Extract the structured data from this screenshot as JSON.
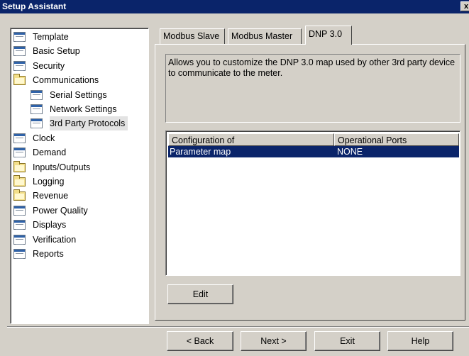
{
  "window": {
    "title": "Setup Assistant",
    "close_label": "x"
  },
  "tree": {
    "selected": "3rd Party Protocols",
    "items": [
      {
        "label": "Template",
        "icon": "doc-icon"
      },
      {
        "label": "Basic Setup",
        "icon": "doc-icon"
      },
      {
        "label": "Security",
        "icon": "doc-icon"
      },
      {
        "label": "Communications",
        "icon": "folder-icon"
      },
      {
        "label": "Serial Settings",
        "icon": "doc-icon"
      },
      {
        "label": "Network Settings",
        "icon": "doc-icon"
      },
      {
        "label": "3rd Party Protocols",
        "icon": "doc-icon"
      },
      {
        "label": "Clock",
        "icon": "doc-icon"
      },
      {
        "label": "Demand",
        "icon": "doc-icon"
      },
      {
        "label": "Inputs/Outputs",
        "icon": "folder-icon"
      },
      {
        "label": "Logging",
        "icon": "folder-icon"
      },
      {
        "label": "Revenue",
        "icon": "folder-icon"
      },
      {
        "label": "Power Quality",
        "icon": "doc-icon"
      },
      {
        "label": "Displays",
        "icon": "doc-icon"
      },
      {
        "label": "Verification",
        "icon": "doc-icon"
      },
      {
        "label": "Reports",
        "icon": "doc-icon"
      }
    ]
  },
  "tabs": [
    {
      "label": "Modbus Slave"
    },
    {
      "label": "Modbus Master"
    },
    {
      "label": "DNP 3.0"
    }
  ],
  "active_tab": "DNP 3.0",
  "description": "Allows you to customize the DNP 3.0 map used by other 3rd party device to communicate to the meter.",
  "table": {
    "columns": [
      "Configuration of",
      "Operational Ports"
    ],
    "rows": [
      {
        "configuration": "Parameter map",
        "ports": "NONE"
      }
    ]
  },
  "buttons": {
    "edit": "Edit",
    "back": "< Back",
    "next": "Next >",
    "exit": "Exit",
    "help": "Help"
  },
  "colors": {
    "title_bar": "#0a246a",
    "selection": "#0a246a",
    "dialog_bg": "#d4d0c8"
  }
}
